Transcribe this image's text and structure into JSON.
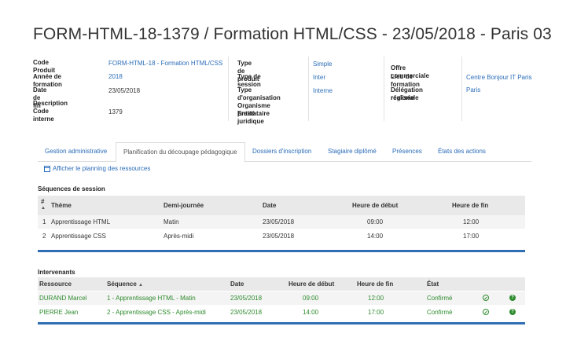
{
  "page": {
    "title": "FORM-HTML-18-1379 / Formation HTML/CSS - 23/05/2018 - Paris 03"
  },
  "info": {
    "col1": {
      "code_produit_label": "Code Produit",
      "code_produit_value": "FORM-HTML-18 - Formation HTML/CSS",
      "annee_label": "Année de formation",
      "annee_value": "2018",
      "date_fin_label": "Date de fin",
      "date_fin_value": "23/05/2018",
      "description_label": "Description",
      "code_interne_label": "Code interne",
      "code_interne_value": "1379"
    },
    "col2": {
      "type_produit_label": "Type de produit",
      "type_produit_value": "Simple",
      "type_session_label": "Type de session",
      "type_session_value": "Inter",
      "type_org_label": "Type d'organisation",
      "type_org_value": "Interne",
      "organisme_label": "Organisme prestataire",
      "entite_label": "Entité juridique"
    },
    "col3": {
      "offre_label": "Offre commerciale",
      "lieu_label": "Lieu de formation",
      "lieu_value": "Centre Bonjour IT Paris",
      "delegation_label_1": "Délégation régionale",
      "delegation_label_2": "réalisée",
      "delegation_value": "Paris"
    }
  },
  "tabs": [
    {
      "label": "Gestion administrative"
    },
    {
      "label": "Planification du découpage pédagogique"
    },
    {
      "label": "Dossiers d'inscription"
    },
    {
      "label": "Stagiaire diplômé"
    },
    {
      "label": "Présences"
    },
    {
      "label": "États des actions"
    }
  ],
  "planning_link": "Afficher le planning des ressources",
  "sequences": {
    "title": "Séquences de session",
    "headers": {
      "num": "#",
      "theme": "Thème",
      "demi": "Demi-journée",
      "date": "Date",
      "debut": "Heure de début",
      "fin": "Heure de fin"
    },
    "rows": [
      {
        "num": "1",
        "theme": "Apprentissage HTML",
        "demi": "Matin",
        "date": "23/05/2018",
        "debut": "09:00",
        "fin": "12:00"
      },
      {
        "num": "2",
        "theme": "Apprentissage CSS",
        "demi": "Après-midi",
        "date": "23/05/2018",
        "debut": "14:00",
        "fin": "17:00"
      }
    ]
  },
  "intervenants": {
    "title": "Intervenants",
    "headers": {
      "ressource": "Ressource",
      "sequence": "Séquence",
      "date": "Date",
      "debut": "Heure de début",
      "fin": "Heure de fin",
      "etat": "État"
    },
    "rows": [
      {
        "ressource": "DURAND Marcel",
        "sequence": "1 - Apprentissage HTML - Matin",
        "date": "23/05/2018",
        "debut": "09:00",
        "fin": "12:00",
        "etat": "Confirmé"
      },
      {
        "ressource": "PIERRE Jean",
        "sequence": "2 - Apprentissage CSS - Après-midi",
        "date": "23/05/2018",
        "debut": "14:00",
        "fin": "17:00",
        "etat": "Confirmé"
      }
    ]
  },
  "colors": {
    "link": "#2a6cb8",
    "accent_bar": "#2f6eb3",
    "success": "#2e8b2e"
  }
}
